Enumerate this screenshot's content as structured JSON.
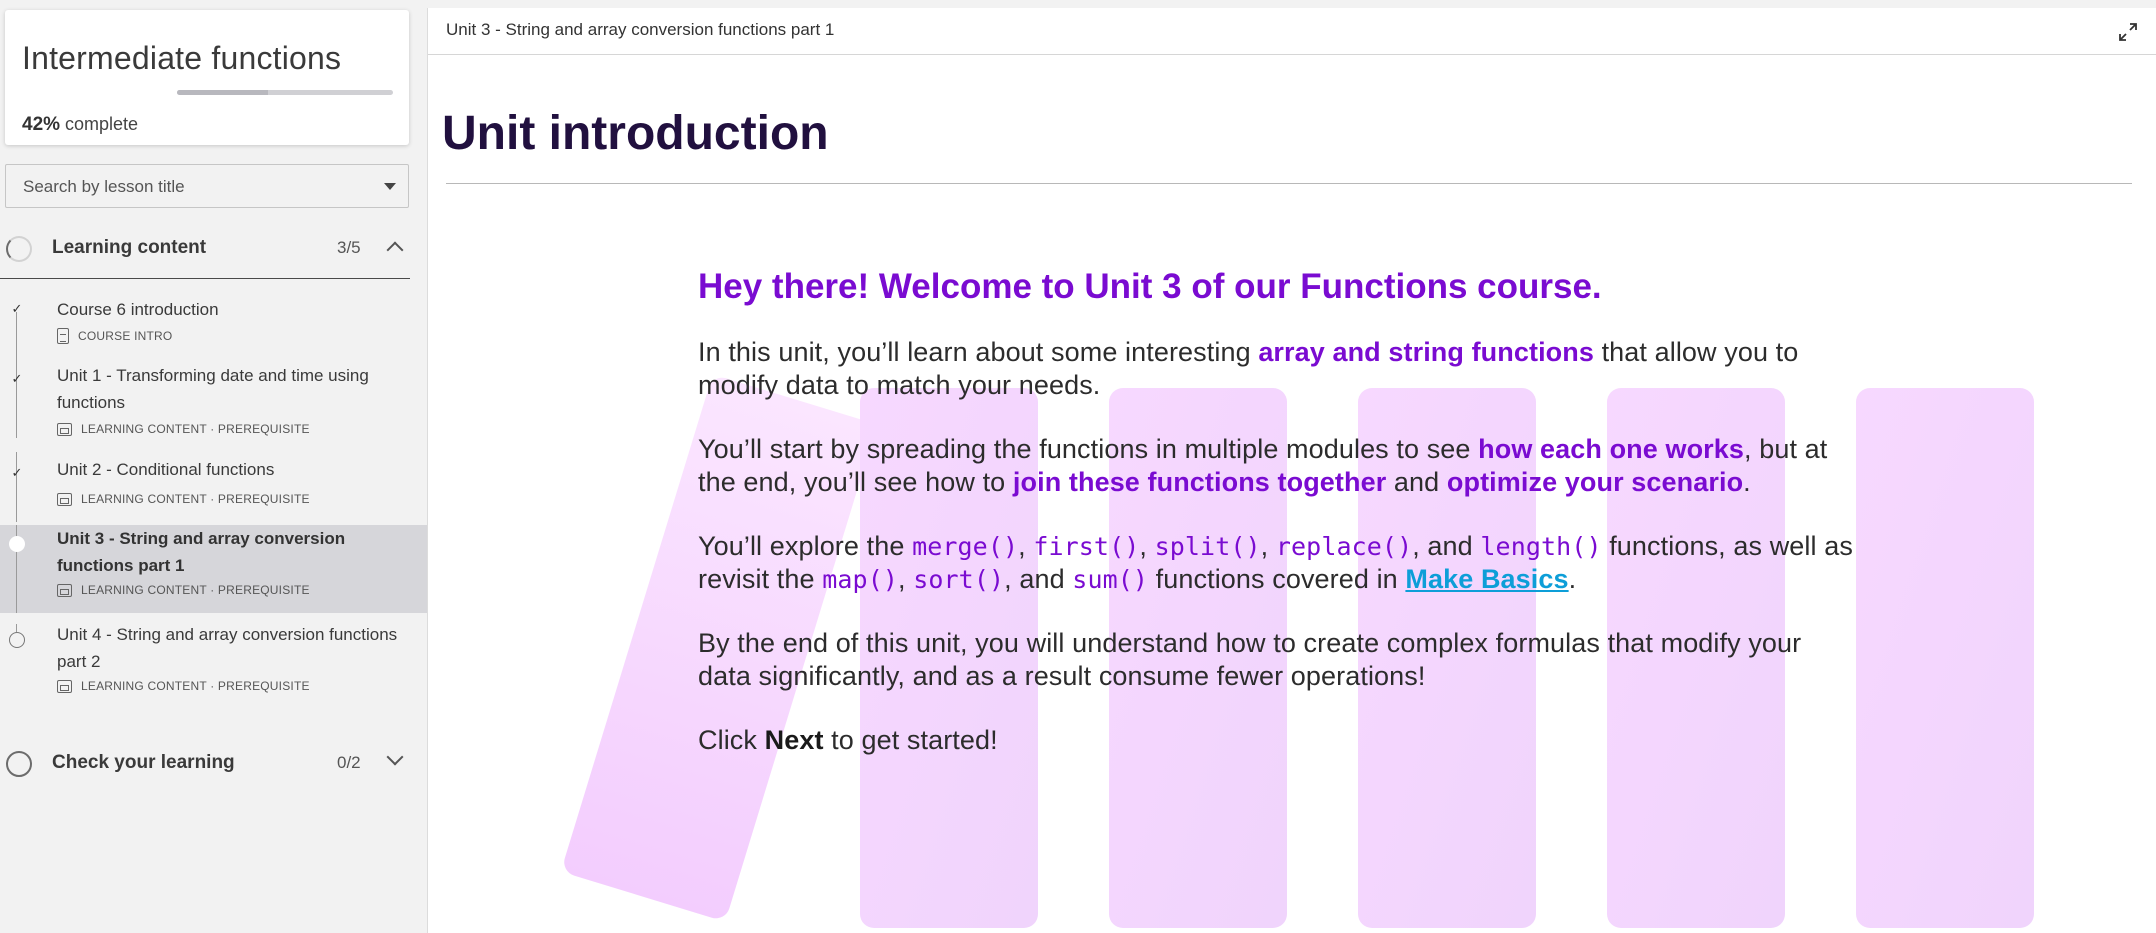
{
  "sidebar": {
    "course_title": "Intermediate functions",
    "progress": {
      "percent": 42,
      "percent_label": "42%",
      "suffix": " complete"
    },
    "search": {
      "placeholder": "Search by lesson title"
    },
    "learning_section": {
      "title": "Learning content",
      "count": "3/5"
    },
    "lessons": [
      {
        "title": "Course 6 introduction",
        "meta": "COURSE INTRO",
        "status": "done"
      },
      {
        "title": "Unit 1 - Transforming date and time using functions",
        "meta": "LEARNING CONTENT · PREREQUISITE",
        "status": "done"
      },
      {
        "title": "Unit 2 - Conditional functions",
        "meta": "LEARNING CONTENT · PREREQUISITE",
        "status": "done"
      },
      {
        "title": "Unit 3 - String and array conversion functions part 1",
        "meta": "LEARNING CONTENT · PREREQUISITE",
        "status": "current"
      },
      {
        "title": "Unit 4 - String and array conversion functions part 2",
        "meta": "LEARNING CONTENT · PREREQUISITE",
        "status": "todo"
      }
    ],
    "check_section": {
      "title": "Check your learning",
      "count": "0/2"
    }
  },
  "main": {
    "topbar_title": "Unit 3 - String and array conversion functions part 1",
    "heading": "Unit introduction",
    "welcome": "Hey there! Welcome to Unit 3 of our Functions course.",
    "p1": {
      "a": "In this unit, you’ll learn about some interesting ",
      "hl": "array and string functions",
      "b": " that allow you to modify data to match your needs."
    },
    "p2": {
      "a": "You’ll start by spreading the functions in multiple modules to see ",
      "hl1": "how each one works",
      "b": ", but at the end, you’ll see how to ",
      "hl2": "join these functions together",
      "c": " and ",
      "hl3": "optimize your scenario",
      "d": "."
    },
    "p3": {
      "a": "You’ll explore the ",
      "f1": "merge()",
      "s1": ", ",
      "f2": "first()",
      "s2": ", ",
      "f3": "split()",
      "s3": ", ",
      "f4": "replace()",
      "s4": ", and ",
      "f5": "length()",
      "b": " functions, as well as revisit the ",
      "f6": "map()",
      "s5": ", ",
      "f7": "sort()",
      "s6": ", and ",
      "f8": "sum()",
      "c": " functions covered in ",
      "link": "Make Basics",
      "d": "."
    },
    "p4": "By the end of this unit, you will understand how to create complex formulas that modify your data significantly, and as a result consume fewer operations!",
    "p5": {
      "a": "Click ",
      "strong": "Next",
      "b": " to get started!"
    }
  },
  "colors": {
    "accent": "#7a0bd1",
    "link": "#0d9ed8",
    "heading": "#21103f",
    "deco": "#f0c8ff"
  },
  "icons": [
    "chevron-up-icon",
    "chevron-down-icon",
    "expand-icon",
    "check-icon",
    "document-icon",
    "slides-icon",
    "caret-down-icon"
  ]
}
